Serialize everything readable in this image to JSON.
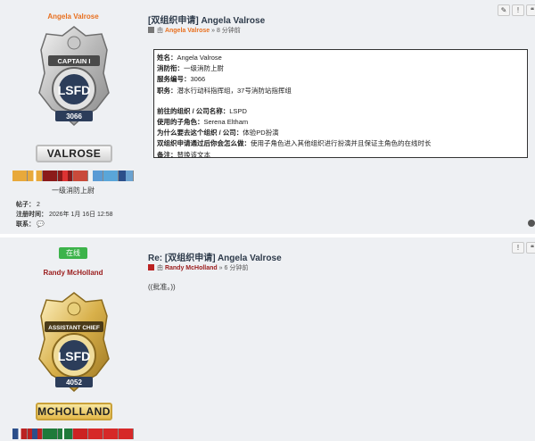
{
  "post1": {
    "username": "Angela Valrose",
    "badge": {
      "rank_text": "CAPTAIN I",
      "dept_text": "LSFD",
      "number": "3066",
      "ring_text": "CITY OF LOS SANTOS"
    },
    "nameplate": "VALROSE",
    "rank": "一级消防上尉",
    "stats": {
      "posts_label": "帖子：",
      "posts_value": "2",
      "joined_label": "注册时间：",
      "joined_value": "2026年 1月 16日 12:58",
      "contact_label": "联系："
    },
    "title": "[双组织申请] Angela Valrose",
    "meta": {
      "prefix": "由",
      "user": "Angela Valrose",
      "time": "» 8 分钟前"
    },
    "application": {
      "name_label": "姓名：",
      "name_value": "Angela Valrose",
      "rank_label": "消防衔：",
      "rank_value": "一级消防上尉",
      "service_label": "服务编号：",
      "service_value": "3066",
      "duty_label": "职务：",
      "duty_value": "潜水行动科指挥组，37号消防站指挥组",
      "org_label": "前往的组织 / 公司名称：",
      "org_value": "LSPD",
      "char_label": "使用的子角色：",
      "char_value": "Serena Eltham",
      "why_label": "为什么要去这个组织 / 公司：",
      "why_value": "体验PD扮演",
      "how_label": "双组织申请通过后你会怎么做：",
      "how_value": "使用子角色进入其他组织进行扮演并且保证主角色的在线时长",
      "note_label": "备注：",
      "note_value": "替换该文本"
    },
    "tools": [
      "✎",
      "!",
      "❝"
    ]
  },
  "post2": {
    "online": "在线",
    "username": "Randy McHolland",
    "badge": {
      "rank_text": "ASSISTANT CHIEF",
      "dept_text": "LSFD",
      "number": "4052",
      "ring_text": "CITY OF LOS SANTOS"
    },
    "nameplate": "MCHOLLAND",
    "title": "Re: [双组织申请] Angela Valrose",
    "meta": {
      "prefix": "由",
      "user": "Randy McHolland",
      "time": "» 6 分钟前"
    },
    "reply": "((批准。))",
    "tools": [
      "!",
      "❝"
    ]
  },
  "colors": {
    "post_bg": "#eef0f3",
    "username_orange": "#e87020",
    "username_red": "#9a1b1b",
    "online_green": "#3cb34a"
  }
}
